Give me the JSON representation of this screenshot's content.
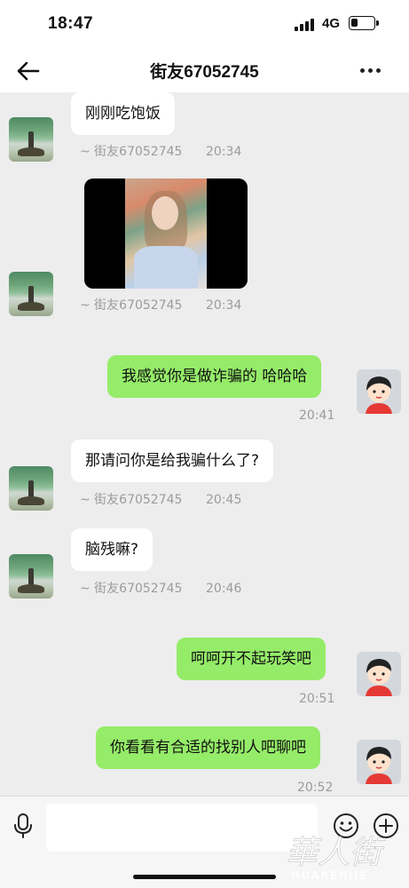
{
  "status_bar": {
    "time": "18:47",
    "network": "4G",
    "battery_level": 0.3
  },
  "nav": {
    "title": "街友67052745"
  },
  "messages": [
    {
      "side": "in",
      "text": "刚刚吃饱饭",
      "sender": "~ 街友67052745",
      "time": "20:34"
    },
    {
      "side": "in",
      "type": "image",
      "sender": "~ 街友67052745",
      "time": "20:34"
    },
    {
      "side": "out",
      "text": "我感觉你是做诈骗的 哈哈哈",
      "time": "20:41"
    },
    {
      "side": "in",
      "text": "那请问你是给我骗什么了?",
      "sender": "~ 街友67052745",
      "time": "20:45"
    },
    {
      "side": "in",
      "text": "脑残嘛?",
      "sender": "~ 街友67052745",
      "time": "20:46"
    },
    {
      "side": "out",
      "text": "呵呵开不起玩笑吧",
      "time": "20:51"
    },
    {
      "side": "out",
      "text": "你看看有合适的找别人吧聊吧",
      "time": "20:52"
    }
  ],
  "input": {
    "value": "",
    "placeholder": ""
  },
  "icons": {
    "back": "arrow-left-icon",
    "more": "more-dots-icon",
    "mic": "microphone-icon",
    "emoji": "emoji-icon",
    "plus": "plus-icon"
  },
  "colors": {
    "outgoing_bubble": "#95ec69",
    "incoming_bubble": "#ffffff",
    "background": "#ededed"
  },
  "watermark": {
    "text": "华人街",
    "subtext": "HUARENJIE"
  }
}
